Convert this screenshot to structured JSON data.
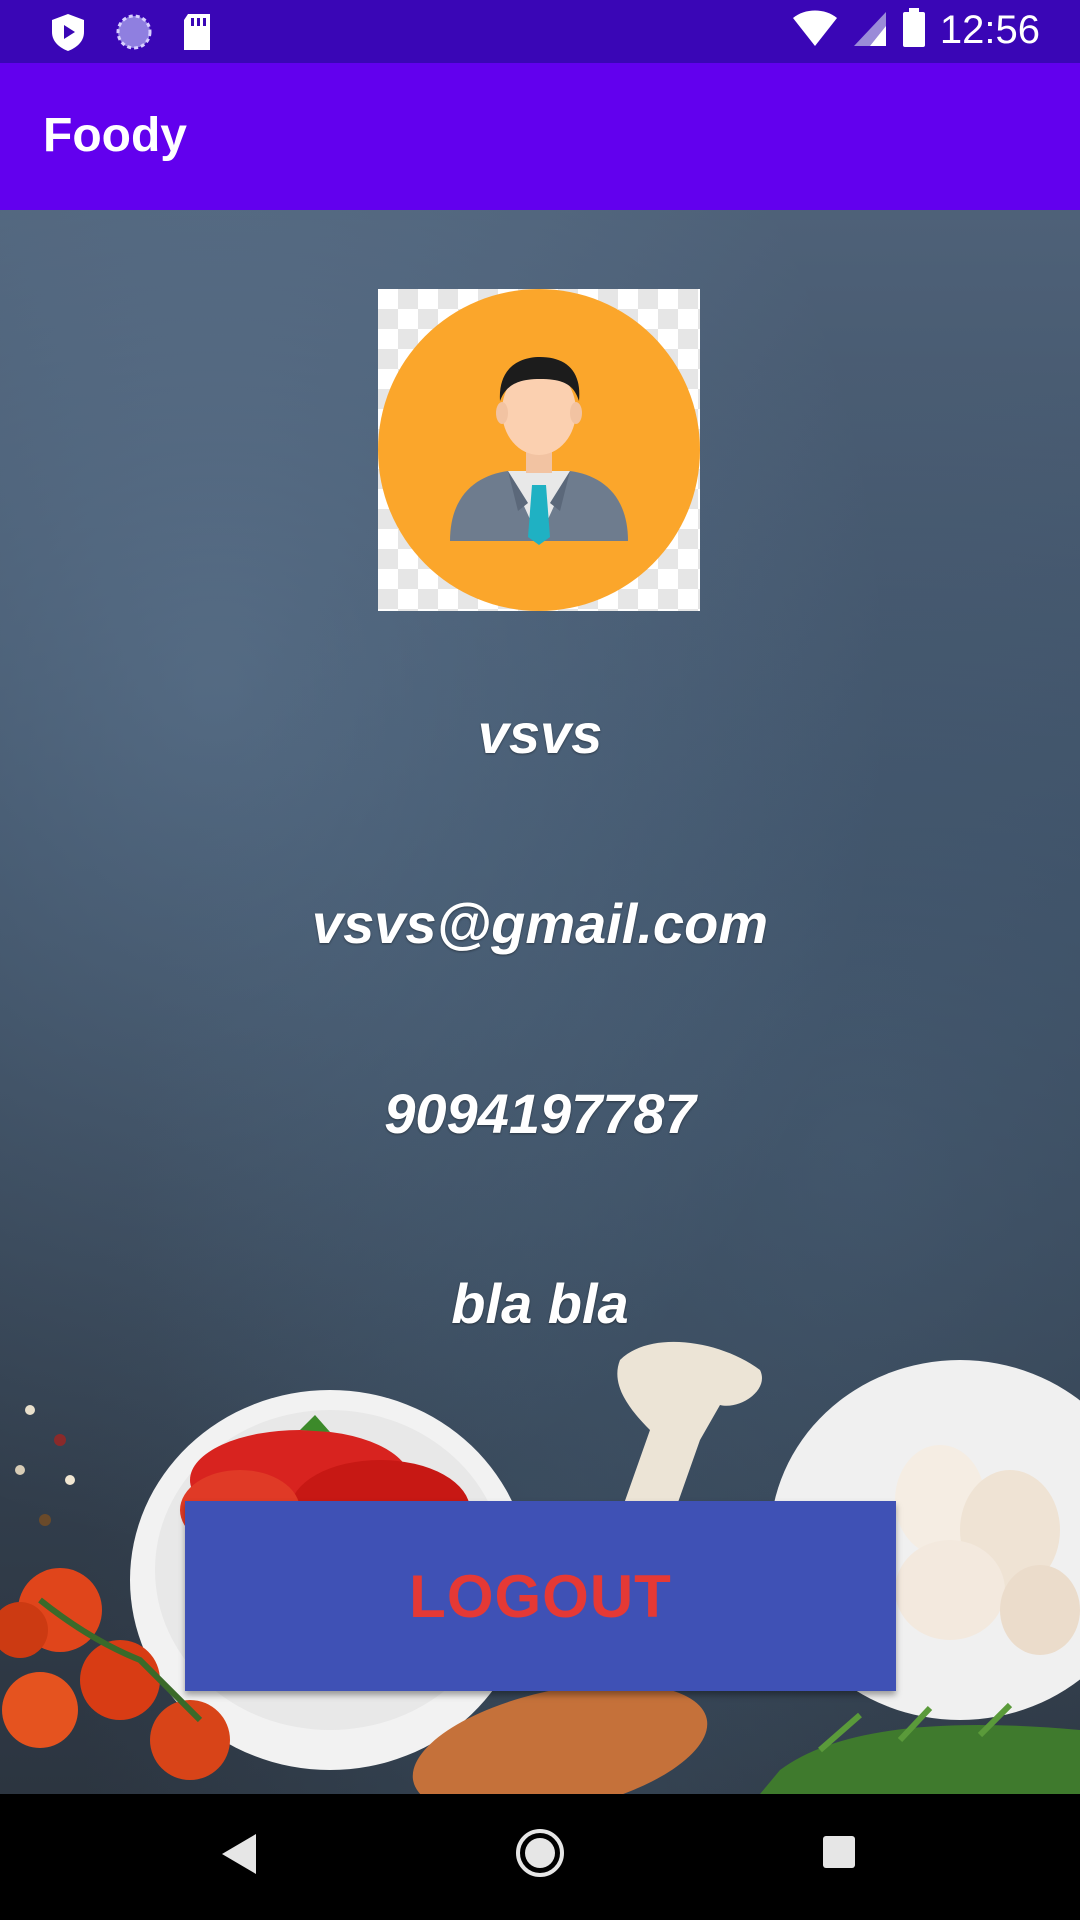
{
  "status_bar": {
    "time": "12:56",
    "icons": [
      "shield-play-icon",
      "sync-circle-icon",
      "sd-card-icon",
      "wifi-icon",
      "signal-icon",
      "battery-icon"
    ]
  },
  "app_bar": {
    "title": "Foody"
  },
  "profile": {
    "avatar_icon": "user-avatar-icon",
    "name": "vsvs",
    "email": "vsvs@gmail.com",
    "phone": "9094197787",
    "address": "bla bla"
  },
  "logout": {
    "label": "LOGOUT"
  },
  "nav_bar": {
    "icons": [
      "back-icon",
      "home-icon",
      "recents-icon"
    ]
  },
  "colors": {
    "status_bar": "#3a06b6",
    "app_bar": "#6200ee",
    "button_bg": "#3f51b5",
    "button_text": "#e53935",
    "avatar_bg": "#fba62b"
  }
}
